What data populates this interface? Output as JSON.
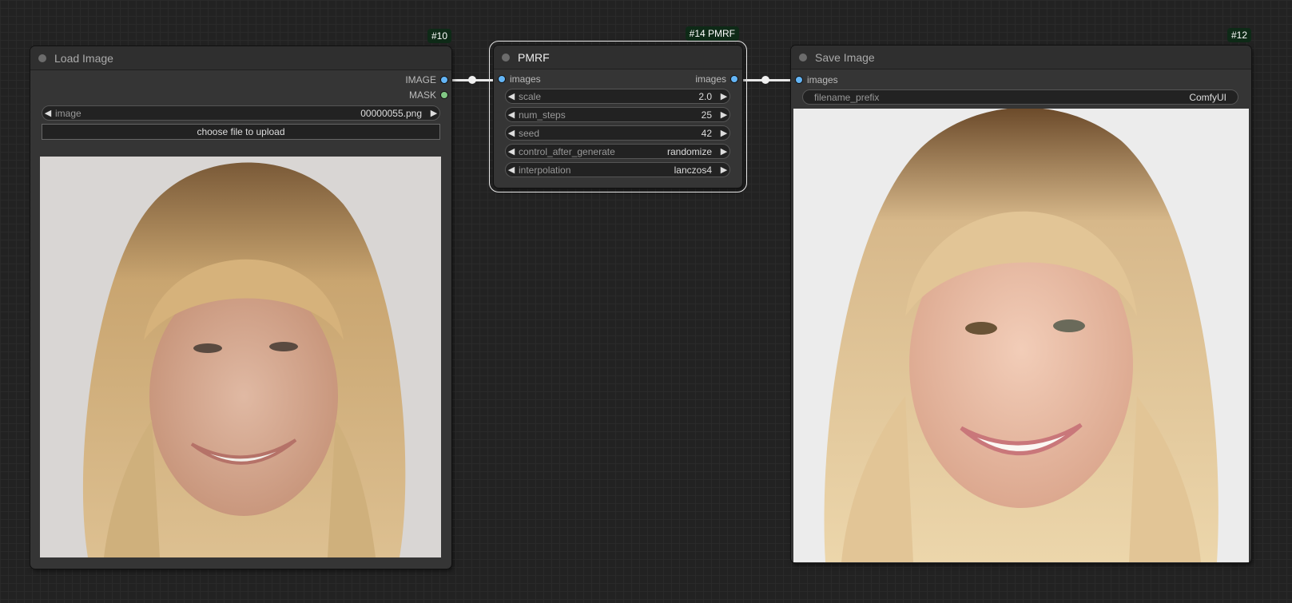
{
  "nodes": {
    "load_image": {
      "badge": "#10",
      "title": "Load Image",
      "outputs": [
        "IMAGE",
        "MASK"
      ],
      "widget": {
        "label": "image",
        "value": "00000055.png"
      },
      "upload_label": "choose file to upload"
    },
    "pmrf": {
      "badge": "#14 PMRF",
      "title": "PMRF",
      "input": "images",
      "output": "images",
      "widgets": [
        {
          "label": "scale",
          "value": "2.0"
        },
        {
          "label": "num_steps",
          "value": "25"
        },
        {
          "label": "seed",
          "value": "42"
        },
        {
          "label": "control_after_generate",
          "value": "randomize"
        },
        {
          "label": "interpolation",
          "value": "lanczos4"
        }
      ]
    },
    "save_image": {
      "badge": "#12",
      "title": "Save Image",
      "input": "images",
      "widget": {
        "label": "filename_prefix",
        "value": "ComfyUI"
      }
    }
  },
  "colors": {
    "canvas": "#222222",
    "node_body": "#353535",
    "port_image": "#64b5f6",
    "port_mask": "#81c784",
    "badge_bg": "#0e2a17"
  }
}
